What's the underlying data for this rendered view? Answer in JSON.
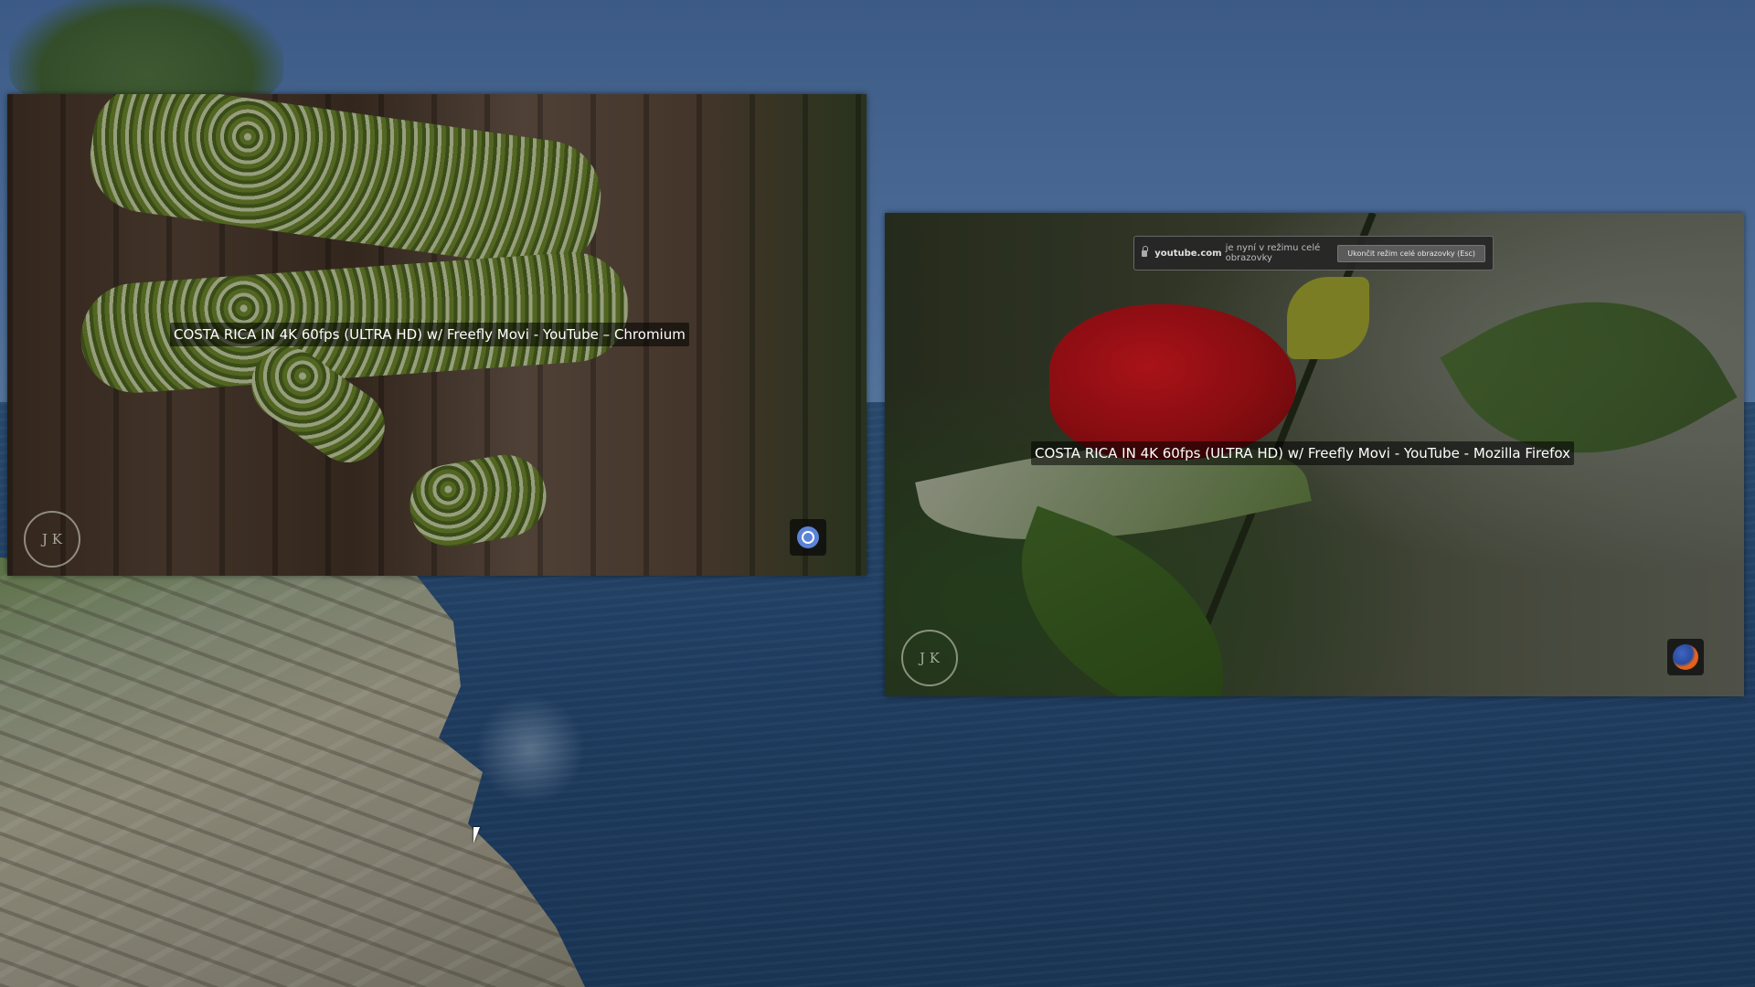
{
  "desktop": {
    "windows": [
      {
        "app": "Chromium",
        "title": "COSTA RICA IN 4K 60fps (ULTRA HD) w/ Freefly Movi - YouTube – Chromium",
        "icon": "chromium-icon",
        "logo_letters": "J K"
      },
      {
        "app": "Mozilla Firefox",
        "title": "COSTA RICA IN 4K 60fps (ULTRA HD) w/ Freefly Movi - YouTube - Mozilla Firefox",
        "icon": "firefox-icon",
        "logo_letters": "J K",
        "fullscreen_notice": {
          "domain": "youtube.com",
          "message": "je nyní v režimu celé obrazovky",
          "button": "Ukončit režim celé obrazovky (Esc)"
        }
      }
    ]
  },
  "colors": {
    "chromium_blue": "#5b83d6",
    "firefox_orange": "#e8661a"
  }
}
